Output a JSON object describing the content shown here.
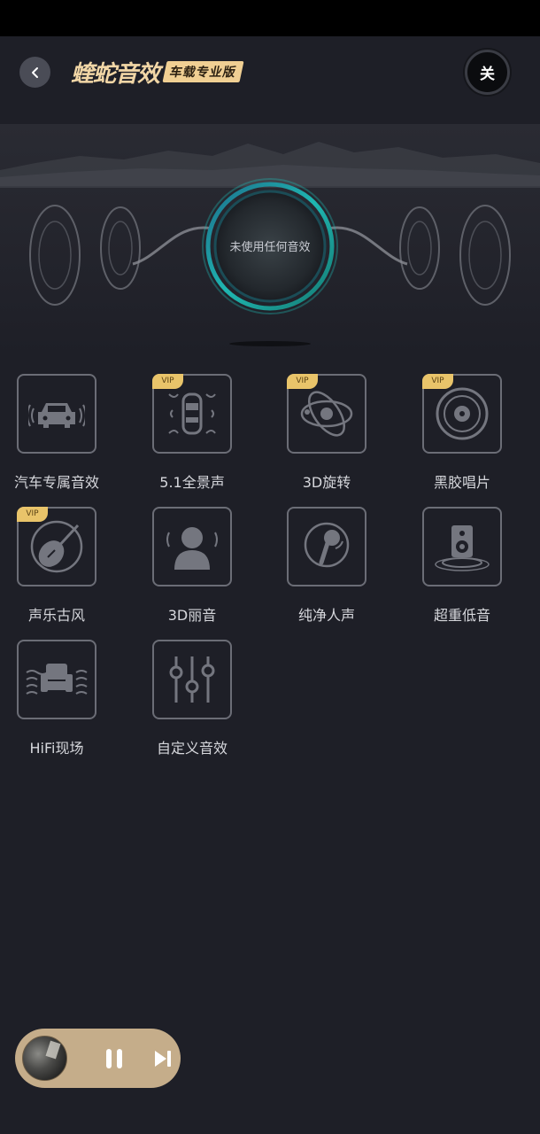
{
  "header": {
    "brand_title": "蝰蛇音效",
    "brand_badge": "车载专业版",
    "power_label": "关"
  },
  "hero": {
    "status_text": "未使用任何音效"
  },
  "effects": [
    {
      "label": "汽车专属音效",
      "vip": false,
      "icon": "car-icon"
    },
    {
      "label": "5.1全景声",
      "vip": true,
      "icon": "surround-car-icon"
    },
    {
      "label": "3D旋转",
      "vip": true,
      "icon": "orbit-icon"
    },
    {
      "label": "黑胶唱片",
      "vip": true,
      "icon": "vinyl-icon"
    },
    {
      "label": "声乐古风",
      "vip": true,
      "icon": "pipa-icon"
    },
    {
      "label": "3D丽音",
      "vip": false,
      "icon": "person-sound-icon"
    },
    {
      "label": "纯净人声",
      "vip": false,
      "icon": "microphone-icon"
    },
    {
      "label": "超重低音",
      "vip": false,
      "icon": "subwoofer-icon"
    },
    {
      "label": "HiFi现场",
      "vip": false,
      "icon": "sofa-icon"
    },
    {
      "label": "自定义音效",
      "vip": false,
      "icon": "equalizer-icon"
    }
  ],
  "vip_label": "VIP",
  "colors": {
    "background": "#1e1f27",
    "accent_ring": "#1fb6b1",
    "vip_badge": "#e9c46a",
    "player": "#c5ad8a"
  }
}
